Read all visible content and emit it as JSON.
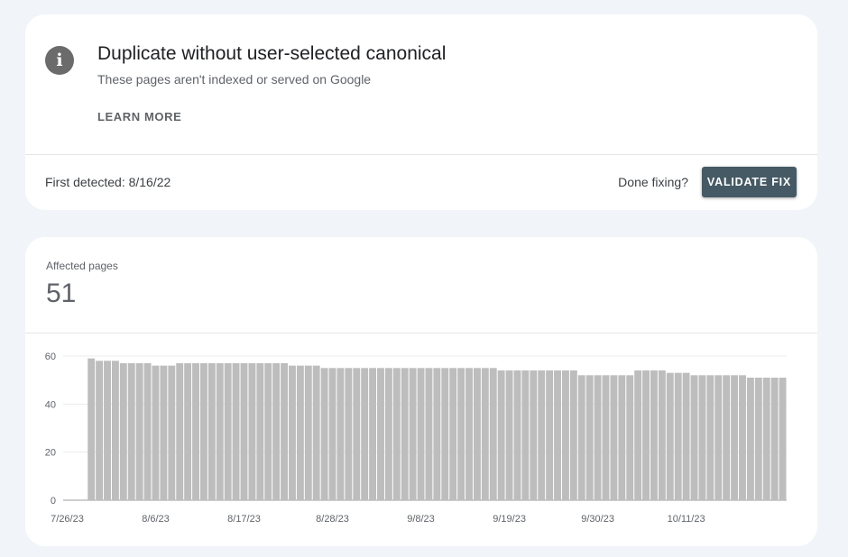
{
  "issue": {
    "title": "Duplicate without user-selected canonical",
    "subtitle": "These pages aren't indexed or served on Google",
    "learn_more_label": "LEARN MORE",
    "first_detected": "First detected: 8/16/22",
    "done_fixing_label": "Done fixing?",
    "validate_button_label": "VALIDATE FIX",
    "icon": "info-icon",
    "icon_glyph": "i"
  },
  "metric": {
    "label": "Affected pages",
    "value": "51"
  },
  "colors": {
    "button": "#455a64",
    "bar": "#bdbdbd",
    "background": "#f1f4f9"
  },
  "chart_data": {
    "type": "bar",
    "title": "",
    "xlabel": "",
    "ylabel": "",
    "ylim": [
      0,
      60
    ],
    "yticks": [
      0,
      20,
      40,
      60
    ],
    "grid": true,
    "x_tick_labels": [
      "7/26/23",
      "8/6/23",
      "8/17/23",
      "8/28/23",
      "9/8/23",
      "9/19/23",
      "9/30/23",
      "10/11/23"
    ],
    "categories": [
      "7/26/23",
      "7/27/23",
      "7/28/23",
      "7/29/23",
      "7/30/23",
      "7/31/23",
      "8/1/23",
      "8/2/23",
      "8/3/23",
      "8/4/23",
      "8/5/23",
      "8/6/23",
      "8/7/23",
      "8/8/23",
      "8/9/23",
      "8/10/23",
      "8/11/23",
      "8/12/23",
      "8/13/23",
      "8/14/23",
      "8/15/23",
      "8/16/23",
      "8/17/23",
      "8/18/23",
      "8/19/23",
      "8/20/23",
      "8/21/23",
      "8/22/23",
      "8/23/23",
      "8/24/23",
      "8/25/23",
      "8/26/23",
      "8/27/23",
      "8/28/23",
      "8/29/23",
      "8/30/23",
      "8/31/23",
      "9/1/23",
      "9/2/23",
      "9/3/23",
      "9/4/23",
      "9/5/23",
      "9/6/23",
      "9/7/23",
      "9/8/23",
      "9/9/23",
      "9/10/23",
      "9/11/23",
      "9/12/23",
      "9/13/23",
      "9/14/23",
      "9/15/23",
      "9/16/23",
      "9/17/23",
      "9/18/23",
      "9/19/23",
      "9/20/23",
      "9/21/23",
      "9/22/23",
      "9/23/23",
      "9/24/23",
      "9/25/23",
      "9/26/23",
      "9/27/23",
      "9/28/23",
      "9/29/23",
      "9/30/23",
      "10/1/23",
      "10/2/23",
      "10/3/23",
      "10/4/23",
      "10/5/23",
      "10/6/23",
      "10/7/23",
      "10/8/23",
      "10/9/23",
      "10/10/23",
      "10/11/23",
      "10/12/23",
      "10/13/23",
      "10/14/23",
      "10/15/23",
      "10/16/23",
      "10/17/23",
      "10/18/23",
      "10/19/23",
      "10/20/23",
      "10/21/23",
      "10/22/23",
      "10/23/23"
    ],
    "values": [
      null,
      null,
      null,
      59,
      58,
      58,
      58,
      57,
      57,
      57,
      57,
      56,
      56,
      56,
      57,
      57,
      57,
      57,
      57,
      57,
      57,
      57,
      57,
      57,
      57,
      57,
      57,
      57,
      56,
      56,
      56,
      56,
      55,
      55,
      55,
      55,
      55,
      55,
      55,
      55,
      55,
      55,
      55,
      55,
      55,
      55,
      55,
      55,
      55,
      55,
      55,
      55,
      55,
      55,
      54,
      54,
      54,
      54,
      54,
      54,
      54,
      54,
      54,
      54,
      52,
      52,
      52,
      52,
      52,
      52,
      52,
      54,
      54,
      54,
      54,
      53,
      53,
      53,
      52,
      52,
      52,
      52,
      52,
      52,
      52,
      51,
      51,
      51,
      51,
      51
    ]
  }
}
